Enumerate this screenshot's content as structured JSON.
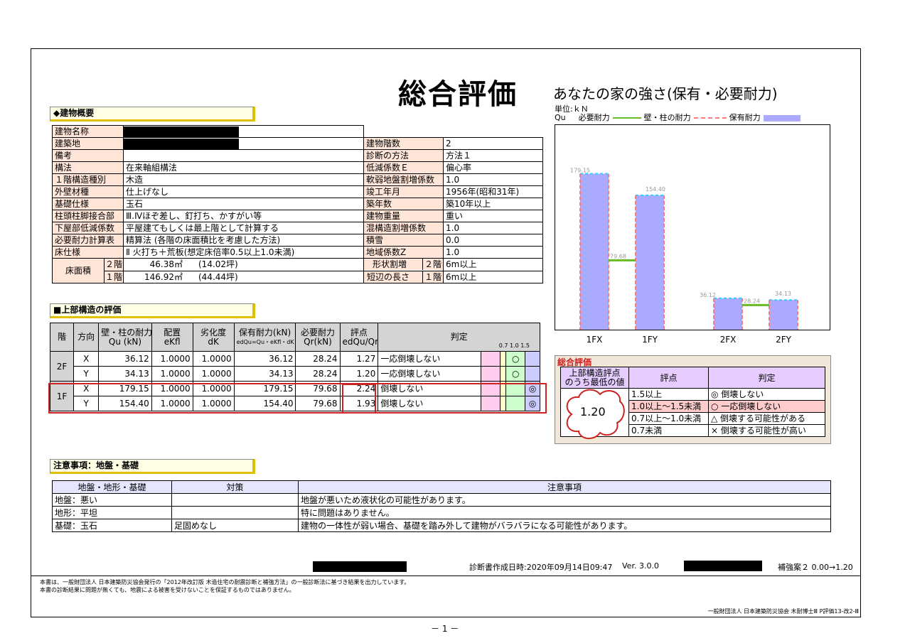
{
  "header": {
    "title": "総合評価",
    "chart_title": "あなたの家の強さ(保有・必要耐力)",
    "unit_label": "単位:ｋＮ",
    "legend_qu": "Qu",
    "legend_required": "必要耐力",
    "legend_wall": "壁・柱の耐力",
    "legend_holding": "保有耐力"
  },
  "overview": {
    "section_title": "◆建物概要",
    "rows": [
      {
        "l1": "建物名称",
        "v1": "",
        "l2": "",
        "v2": ""
      },
      {
        "l1": "建築地",
        "v1": "",
        "l2": "建物階数",
        "v2": "2"
      },
      {
        "l1": "備考",
        "v1": "",
        "l2": "診断の方法",
        "v2": "方法１"
      },
      {
        "l1": "構法",
        "v1": "在来軸組構法",
        "l2": "低減係数Ｅ",
        "v2": "偏心率"
      },
      {
        "l1": "１階構造種別",
        "v1": "木造",
        "l2": "軟弱地盤割増係数",
        "v2": "1.0"
      },
      {
        "l1": "外壁材種",
        "v1": "仕上げなし",
        "l2": "竣工年月",
        "v2": "1956年(昭和31年)"
      },
      {
        "l1": "基礎仕様",
        "v1": "玉石",
        "l2": "築年数",
        "v2": "築10年以上"
      },
      {
        "l1": "柱頭柱脚接合部",
        "v1": "Ⅲ.Ⅳほぞ差し、釘打ち、かすがい等",
        "l2": "建物重量",
        "v2": "重い"
      },
      {
        "l1": "下屋部低減係数",
        "v1": "平屋建てもしくは最上階として計算する",
        "l2": "混構造割増係数",
        "v2": "1.0"
      },
      {
        "l1": "必要耐力計算表",
        "v1": "精算法 (各階の床面積比を考慮した方法)",
        "l2": "積雪",
        "v2": "0.0"
      },
      {
        "l1": "床仕様",
        "v1": "Ⅱ 火打ち＋荒板(想定床倍率0.5以上1.0未満)",
        "l2": "地域係数Z",
        "v2": "1.0"
      }
    ],
    "floor_area_label": "床面積",
    "floor2_label": "２階",
    "floor1_label": "１階",
    "floor2_area": "46.38㎡",
    "floor2_tsubo": "(14.02坪)",
    "floor1_area": "146.92㎡",
    "floor1_tsubo": "(44.44坪)",
    "shape_label": "形状割増",
    "shape_floor": "２階",
    "shape_value": "6m以上",
    "short_label": "短辺の長さ",
    "short_floor": "１階",
    "short_value": "6m以上"
  },
  "evaluation": {
    "section_title": "■上部構造の評価",
    "headers": {
      "floor": "階",
      "dir": "方向",
      "wall": "壁・柱の耐力",
      "wall2": "Qu (kN)",
      "place": "配置",
      "place2": "eKfl",
      "deg": "劣化度",
      "deg2": "dK",
      "hold": "保有耐力(kN)",
      "hold2": "edQu=Qu・eKfl・dK",
      "req": "必要耐力",
      "req2": "Qr(kN)",
      "score": "評点",
      "score2": "edQu/Qr",
      "judge": "判定",
      "scale": "0.7 1.0   1.5"
    },
    "rows": [
      {
        "floor": "2F",
        "dir": "X",
        "qu": "36.12",
        "ekfl": "1.0000",
        "dk": "1.0000",
        "hold": "36.12",
        "req": "28.24",
        "score": "1.27",
        "judge": "一応倒壊しない",
        "mark": "○"
      },
      {
        "floor": "",
        "dir": "Y",
        "qu": "34.13",
        "ekfl": "1.0000",
        "dk": "1.0000",
        "hold": "34.13",
        "req": "28.24",
        "score": "1.20",
        "judge": "一応倒壊しない",
        "mark": "○"
      },
      {
        "floor": "1F",
        "dir": "X",
        "qu": "179.15",
        "ekfl": "1.0000",
        "dk": "1.0000",
        "hold": "179.15",
        "req": "79.68",
        "score": "2.24",
        "judge": "倒壊しない",
        "mark": "◎"
      },
      {
        "floor": "",
        "dir": "Y",
        "qu": "154.40",
        "ekfl": "1.0000",
        "dk": "1.0000",
        "hold": "154.40",
        "req": "79.68",
        "score": "1.93",
        "judge": "倒壊しない",
        "mark": "◎"
      }
    ]
  },
  "chart_data": {
    "type": "bar",
    "categories": [
      "1FX",
      "1FY",
      "2FX",
      "2FY"
    ],
    "series": [
      {
        "name": "保有耐力",
        "values": [
          179.15,
          154.4,
          36.12,
          34.13
        ]
      },
      {
        "name": "必要耐力",
        "values": [
          79.68,
          79.68,
          28.24,
          28.24
        ]
      }
    ],
    "value_labels": [
      "179.15",
      "154.40",
      "36.12",
      "34.13"
    ],
    "required_labels": [
      "79.68",
      "28.24"
    ],
    "ylim": [
      0,
      200
    ],
    "grid": false,
    "colors": {
      "holding": "#aaaaff",
      "required": "#66bb22",
      "wall": "#ff7777",
      "border": "#33ccff"
    }
  },
  "overall": {
    "title": "総合評価",
    "head_min1": "上部構造評点",
    "head_min2": "のうち最低の値",
    "head_score": "評点",
    "head_judge": "判定",
    "value": "1.20",
    "rows": [
      {
        "score": "1.5以上",
        "judge": "◎ 倒壊しない"
      },
      {
        "score": "1.0以上～1.5未満",
        "judge": "○ 一応倒壊しない"
      },
      {
        "score": "0.7以上～1.0未満",
        "judge": "△ 倒壊する可能性がある"
      },
      {
        "score": "0.7未満",
        "judge": "× 倒壊する可能性が高い"
      }
    ]
  },
  "notes": {
    "section_title": "注意事項：地盤・基礎",
    "headers": [
      "地盤・地形・基礎",
      "対策",
      "注意事項"
    ],
    "rows": [
      {
        "a": "地盤：悪い",
        "b": "",
        "c": "地盤が悪いため液状化の可能性があります。"
      },
      {
        "a": "地形：平坦",
        "b": "",
        "c": "特に問題はありません。"
      },
      {
        "a": "基礎：玉石",
        "b": "足固めなし",
        "c": "建物の一体性が弱い場合、基礎を踏み外して建物がバラバラになる可能性があります。"
      }
    ]
  },
  "footer": {
    "created": "診断書作成日時:2020年09月14日09:47",
    "version": "Ver. 3.0.0",
    "plan": "補強案２ 0.00→1.20",
    "disclaimer1": "本書は、一般財団法人 日本建築防災協会発行の「2012年改訂版 木造住宅の耐震診断と補強方法」の一般診断法に基づき結果を出力しています。",
    "disclaimer2": "本書の診断結果に問題が無くても、地震による被害を受けないことを保証するものではありません。",
    "org": "一般財団法人 日本建築防災協会 木耐博士Ⅲ P評価13-改2-Ⅲ",
    "page": "－ 1 －"
  }
}
